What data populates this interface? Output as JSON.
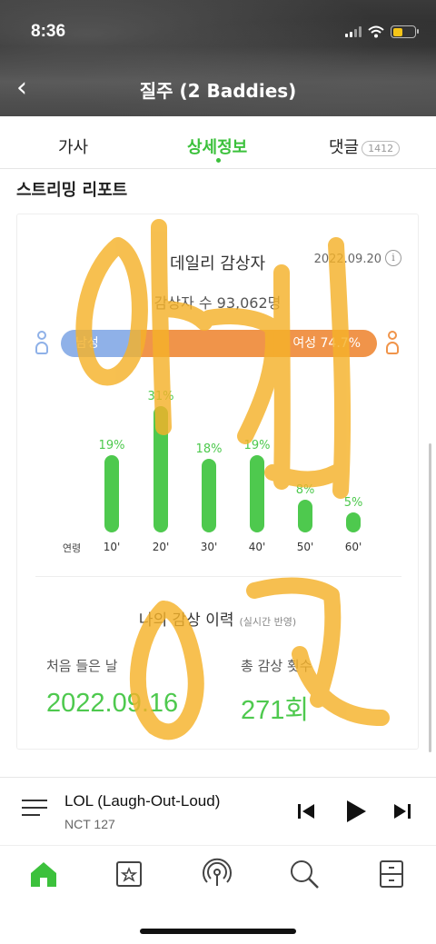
{
  "status_bar": {
    "time": "8:36"
  },
  "header": {
    "back_icon": "chevron-left-icon",
    "title": "질주 (2 Baddies)"
  },
  "tabs": [
    {
      "label": "가사"
    },
    {
      "label": "상세정보",
      "active": true
    },
    {
      "label": "댓글",
      "badge": "1412"
    }
  ],
  "section_title": "스트리밍 리포트",
  "daily": {
    "title": "데일리 감상자",
    "date": "2022.09.20",
    "info_icon": "i",
    "listeners": "감상자 수 93,062명",
    "male_label": "남성 25.3%",
    "female_label": "여성 74.7%",
    "male_pct": 25.3,
    "female_pct": 74.7
  },
  "age_chart": {
    "axis_label": "연령",
    "categories": [
      "10'",
      "20'",
      "30'",
      "40'",
      "50'",
      "60'"
    ],
    "values": [
      19,
      31,
      18,
      19,
      8,
      5
    ],
    "labels": [
      "19%",
      "31%",
      "18%",
      "19%",
      "8%",
      "5%"
    ]
  },
  "history": {
    "title": "나의 감상 이력",
    "subtitle": "(실시간 반영)",
    "first_label": "처음 들은 날",
    "first_value": "2022.09.16",
    "count_label": "총 감상 횟수",
    "count_value": "271회"
  },
  "player": {
    "song": "LOL (Laugh-Out-Loud)",
    "artist": "NCT 127"
  },
  "colors": {
    "accent_green": "#3cc13c",
    "male_blue": "#8fb1e8",
    "female_orange": "#f0944a",
    "scribble": "#f5b22a"
  },
  "nav_icons": [
    "home-icon",
    "library-icon",
    "podcast-icon",
    "search-icon",
    "storage-icon"
  ]
}
